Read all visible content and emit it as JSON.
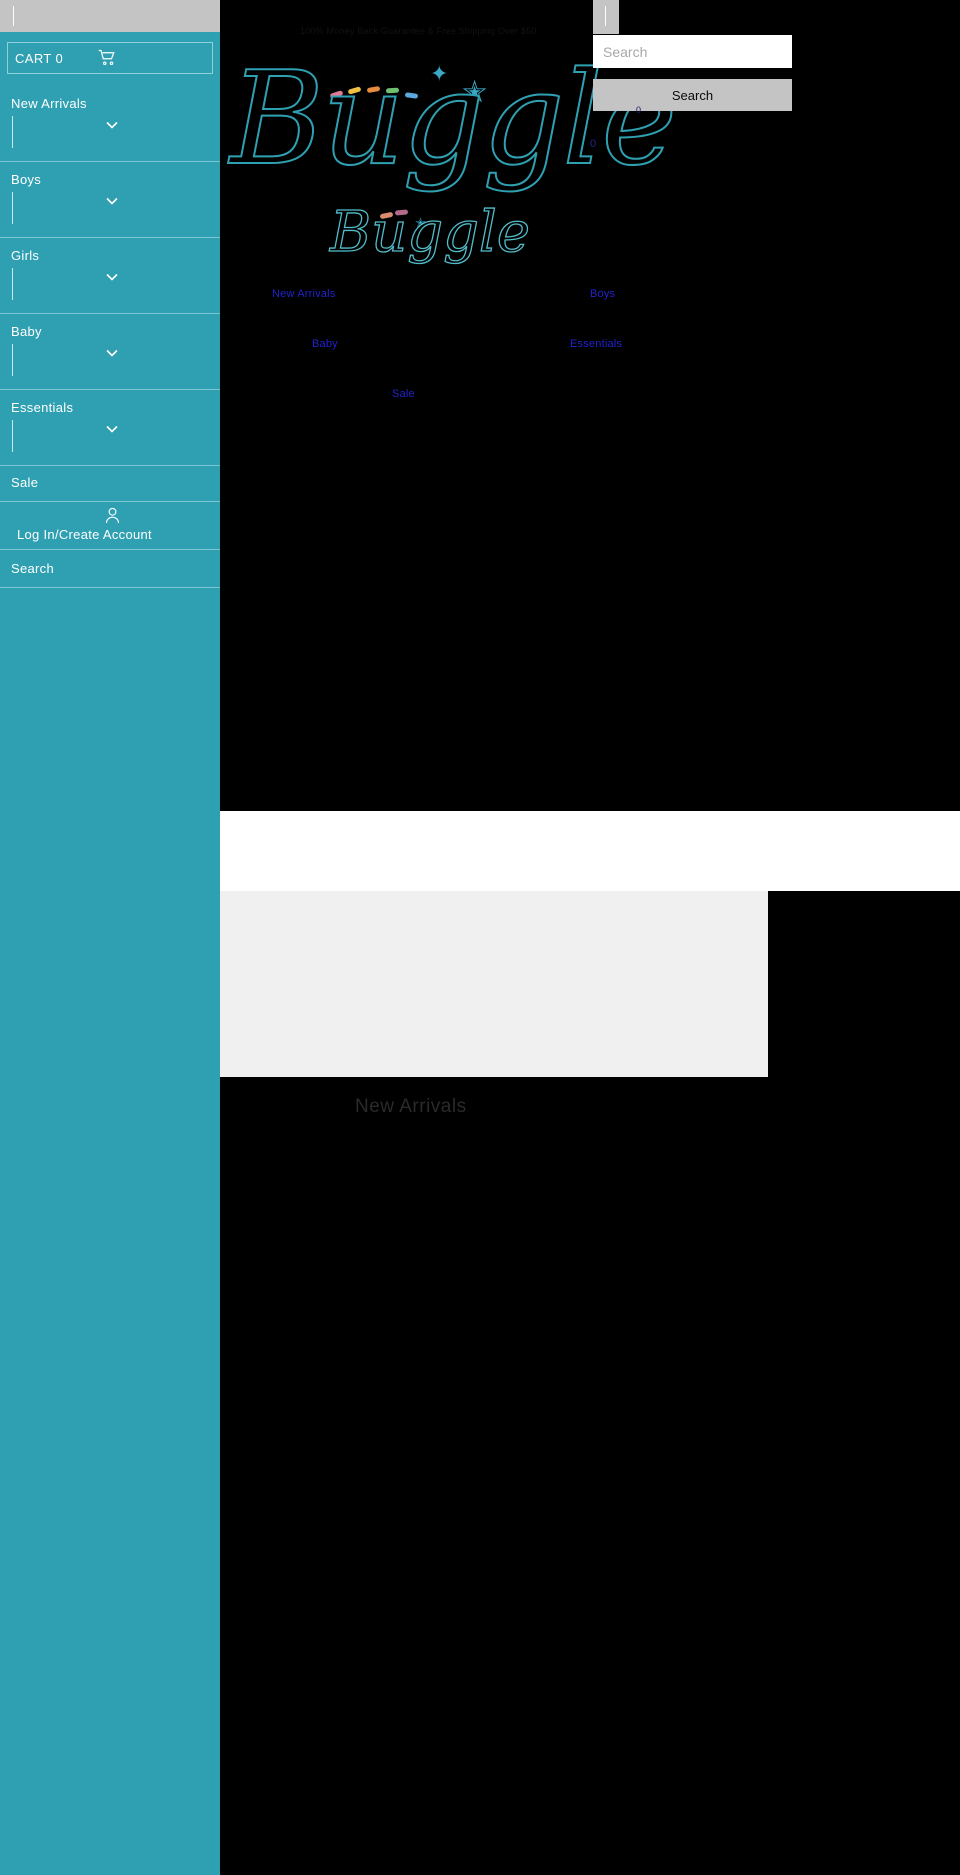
{
  "sidebar": {
    "cart": {
      "label": "CART 0",
      "icon": "shopping-cart-icon"
    },
    "menu_items": [
      {
        "label": "New Arrivals",
        "expandable": true
      },
      {
        "label": "Boys",
        "expandable": true
      },
      {
        "label": "Girls",
        "expandable": true
      },
      {
        "label": "Baby",
        "expandable": true
      },
      {
        "label": "Essentials",
        "expandable": true
      },
      {
        "label": "Sale",
        "expandable": false
      }
    ],
    "account": {
      "label": "Log In/Create Account",
      "icon": "user-icon"
    },
    "search": {
      "label": "Search"
    },
    "background_color": "#2fa0b2",
    "divider_color": "#7ec6d2"
  },
  "main": {
    "announcement": "100% Money Back Guarantee & Free Shipping Over $50",
    "logo": {
      "primary": "Buggle",
      "secondary": "Buggle"
    },
    "search_widget": {
      "placeholder": "Search",
      "value": "",
      "button_label": "Search",
      "trailing_text": "0",
      "count_text": "0"
    },
    "nav_links": [
      "New Arrivals",
      "Boys",
      "Baby",
      "Essentials",
      "Sale"
    ],
    "section_heading": "New Arrivals"
  },
  "colors": {
    "teal": "#2fa0b2",
    "link_blue": "#2222cc",
    "button_gray": "#c4c4c4",
    "page_black": "#000000",
    "band_white": "#ffffff",
    "band_gray": "#f0f0f0"
  }
}
